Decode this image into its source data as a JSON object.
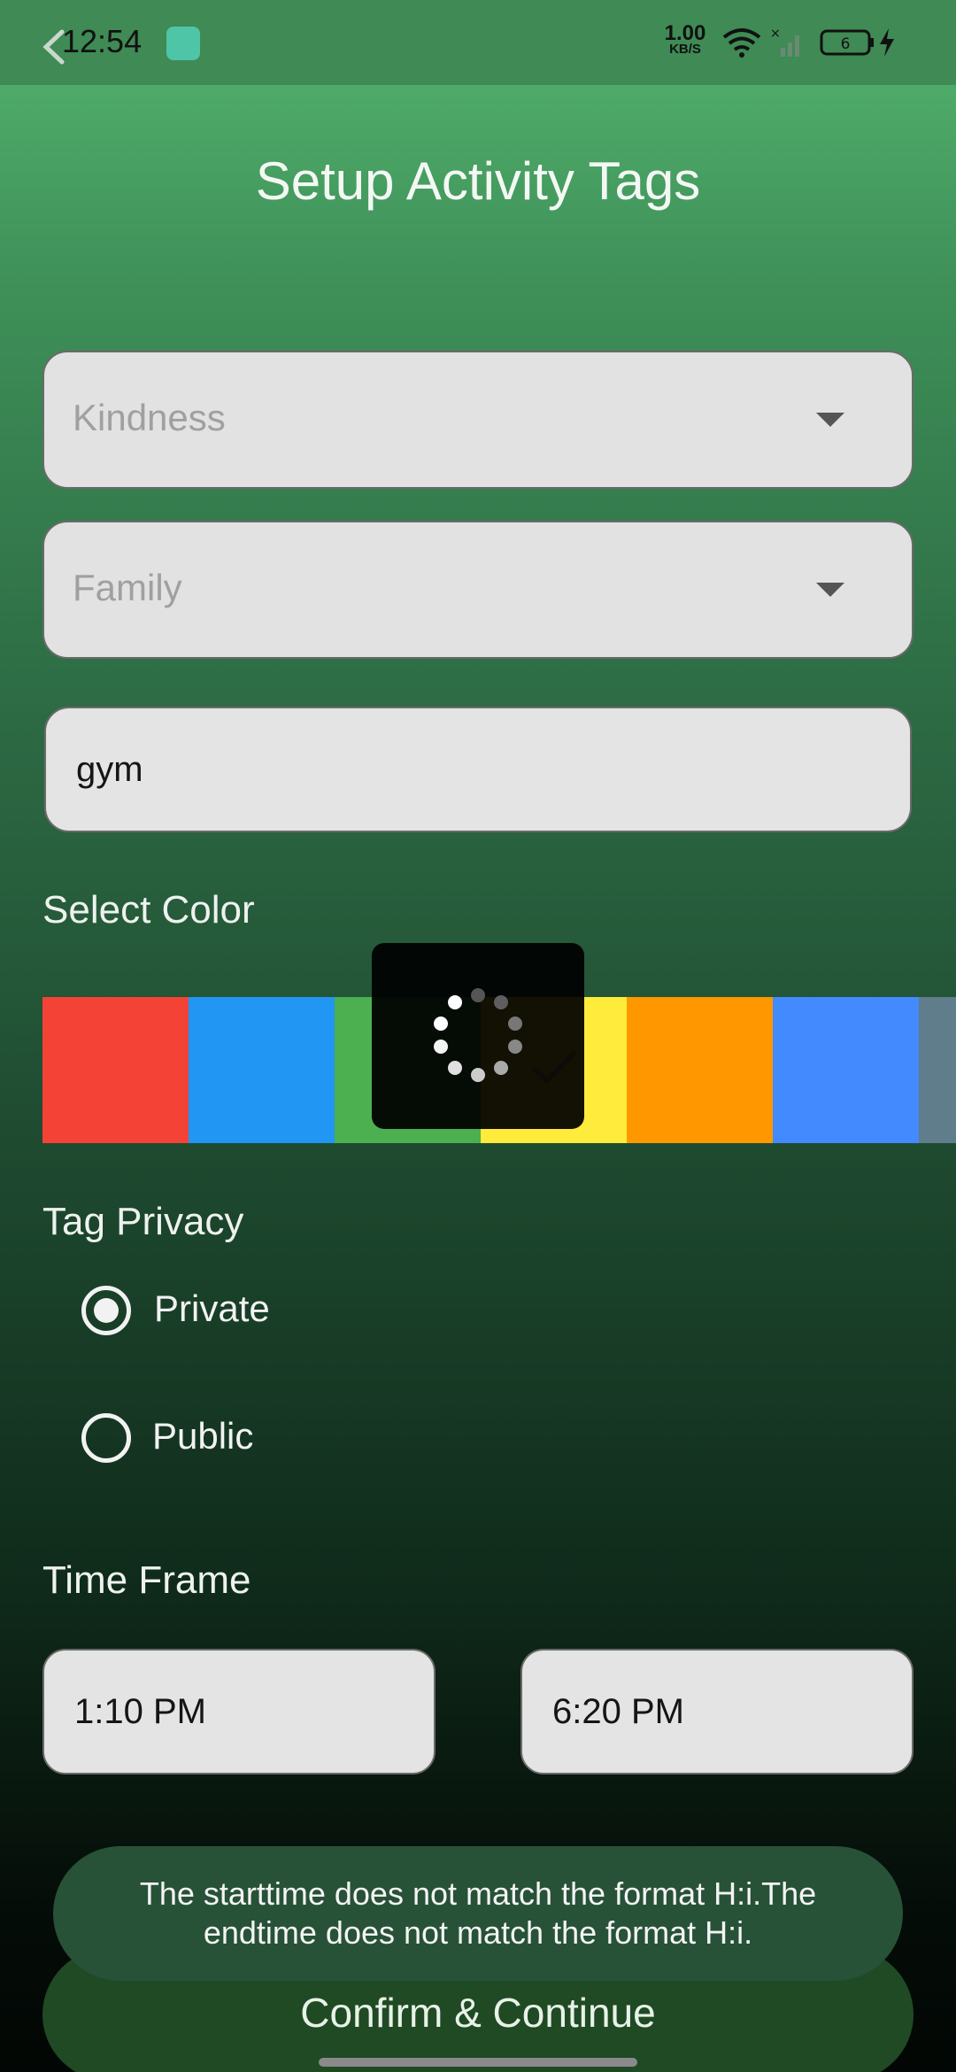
{
  "status_bar": {
    "time": "12:54",
    "net_speed_value": "1.00",
    "net_speed_unit": "KB/S",
    "battery_level": "6"
  },
  "header": {
    "title": "Setup Activity Tags"
  },
  "form": {
    "category_dropdown": {
      "value": "Kindness"
    },
    "group_dropdown": {
      "value": "Family"
    },
    "tag_name_input": {
      "value": "gym"
    },
    "color_section_label": "Select Color",
    "colors": [
      "#f44336",
      "#2196f3",
      "#4caf50",
      "#ffeb3b",
      "#ff9800",
      "#448aff",
      "#607d8b"
    ],
    "selected_color": "#ffeb3b",
    "privacy_label": "Tag Privacy",
    "privacy_options": [
      {
        "label": "Private",
        "selected": true
      },
      {
        "label": "Public",
        "selected": false
      }
    ],
    "time_frame_label": "Time Frame",
    "start_time": "1:10 PM",
    "end_time": "6:20 PM",
    "confirm_label": "Confirm & Continue"
  },
  "toast": {
    "message": "The starttime does not match the format H:i.The endtime does not match the format H:i."
  }
}
